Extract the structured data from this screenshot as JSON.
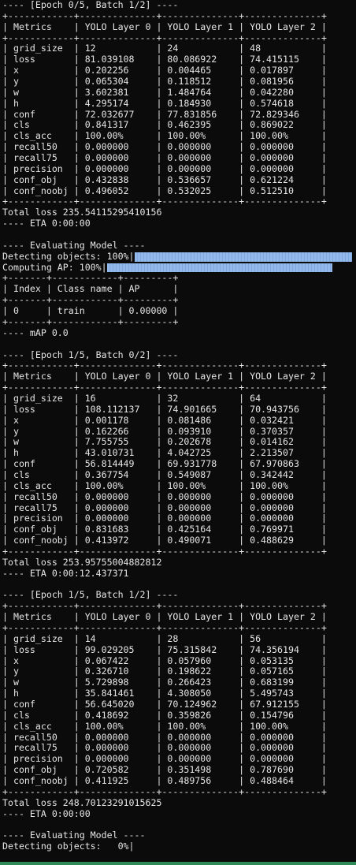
{
  "terminal": {
    "lines": [
      "---- [Epoch 0/5, Batch 1/2] ----",
      "+------------+--------------+--------------+--------------+",
      "| Metrics    | YOLO Layer 0 | YOLO Layer 1 | YOLO Layer 2 |",
      "+------------+--------------+--------------+--------------+",
      "| grid_size  | 12           | 24           | 48           |",
      "| loss       | 81.039108    | 80.086922    | 74.415115    |",
      "| x          | 0.202256     | 0.004465     | 0.017897     |",
      "| y          | 0.065304     | 0.118512     | 0.081956     |",
      "| w          | 3.602381     | 1.484764     | 0.042280     |",
      "| h          | 4.295174     | 0.184930     | 0.574618     |",
      "| conf       | 72.032677    | 77.831856    | 72.829346    |",
      "| cls        | 0.841317     | 0.462395     | 0.869022     |",
      "| cls_acc    | 100.00%      | 100.00%      | 100.00%      |",
      "| recall50   | 0.000000     | 0.000000     | 0.000000     |",
      "| recall75   | 0.000000     | 0.000000     | 0.000000     |",
      "| precision  | 0.000000     | 0.000000     | 0.000000     |",
      "| conf_obj   | 0.432838     | 0.536657     | 0.621224     |",
      "| conf_noobj | 0.496052     | 0.532025     | 0.512510     |",
      "+------------+--------------+--------------+--------------+",
      "Total loss 235.54115295410156",
      "---- ETA 0:00:00",
      "",
      "---- Evaluating Model ----",
      "Detecting objects: 100%|",
      "Computing AP: 100%|",
      "+-------+------------+---------+",
      "| Index | Class name | AP      |",
      "+-------+------------+---------+",
      "| 0     | train      | 0.00000 |",
      "+-------+------------+---------+",
      "---- mAP 0.0",
      "",
      "---- [Epoch 1/5, Batch 0/2] ----",
      "+------------+--------------+--------------+--------------+",
      "| Metrics    | YOLO Layer 0 | YOLO Layer 1 | YOLO Layer 2 |",
      "+------------+--------------+--------------+--------------+",
      "| grid_size  | 16           | 32           | 64           |",
      "| loss       | 108.112137   | 74.901665    | 70.943756    |",
      "| x          | 0.001178     | 0.081486     | 0.032421     |",
      "| y          | 0.162266     | 0.093910     | 0.370357     |",
      "| w          | 7.755755     | 0.202678     | 0.014162     |",
      "| h          | 43.010731    | 4.042725     | 2.213507     |",
      "| conf       | 56.814449    | 69.931778    | 67.970863    |",
      "| cls        | 0.367754     | 0.549087     | 0.342442     |",
      "| cls_acc    | 100.00%      | 100.00%      | 100.00%      |",
      "| recall50   | 0.000000     | 0.000000     | 0.000000     |",
      "| recall75   | 0.000000     | 0.000000     | 0.000000     |",
      "| precision  | 0.000000     | 0.000000     | 0.000000     |",
      "| conf_obj   | 0.831683     | 0.425164     | 0.769971     |",
      "| conf_noobj | 0.413972     | 0.490071     | 0.488629     |",
      "+------------+--------------+--------------+--------------+",
      "Total loss 253.95755004882812",
      "---- ETA 0:00:12.437371",
      "",
      "---- [Epoch 1/5, Batch 1/2] ----",
      "+------------+--------------+--------------+--------------+",
      "| Metrics    | YOLO Layer 0 | YOLO Layer 1 | YOLO Layer 2 |",
      "+------------+--------------+--------------+--------------+",
      "| grid_size  | 14           | 28           | 56           |",
      "| loss       | 99.029205    | 75.315842    | 74.356194    |",
      "| x          | 0.067422     | 0.057960     | 0.053135     |",
      "| y          | 0.326710     | 0.198622     | 0.057165     |",
      "| w          | 5.729898     | 0.266423     | 0.683199     |",
      "| h          | 35.841461    | 4.308050     | 5.495743     |",
      "| conf       | 56.645020    | 70.124962    | 67.912155    |",
      "| cls        | 0.418692     | 0.359826     | 0.154796     |",
      "| cls_acc    | 100.00%      | 100.00%      | 100.00%      |",
      "| recall50   | 0.000000     | 0.000000     | 0.000000     |",
      "| recall75   | 0.000000     | 0.000000     | 0.000000     |",
      "| precision  | 0.000000     | 0.000000     | 0.000000     |",
      "| conf_obj   | 0.720582     | 0.351498     | 0.787690     |",
      "| conf_noobj | 0.411925     | 0.489756     | 0.488464     |",
      "+------------+--------------+--------------+--------------+",
      "Total loss 248.70123291015625",
      "---- ETA 0:00:00",
      "",
      "---- Evaluating Model ----",
      "Detecting objects:   0%|"
    ],
    "progress_bars": [
      {
        "line": 23,
        "label": "Detecting objects",
        "percent": 100
      },
      {
        "line": 24,
        "label": "Computing AP",
        "percent": 100
      }
    ],
    "colors": {
      "background": "#0b0b0b",
      "foreground": "#e6e6e6",
      "progress_fill": "#93b8ea",
      "status_strip": "#2e8b57"
    }
  }
}
